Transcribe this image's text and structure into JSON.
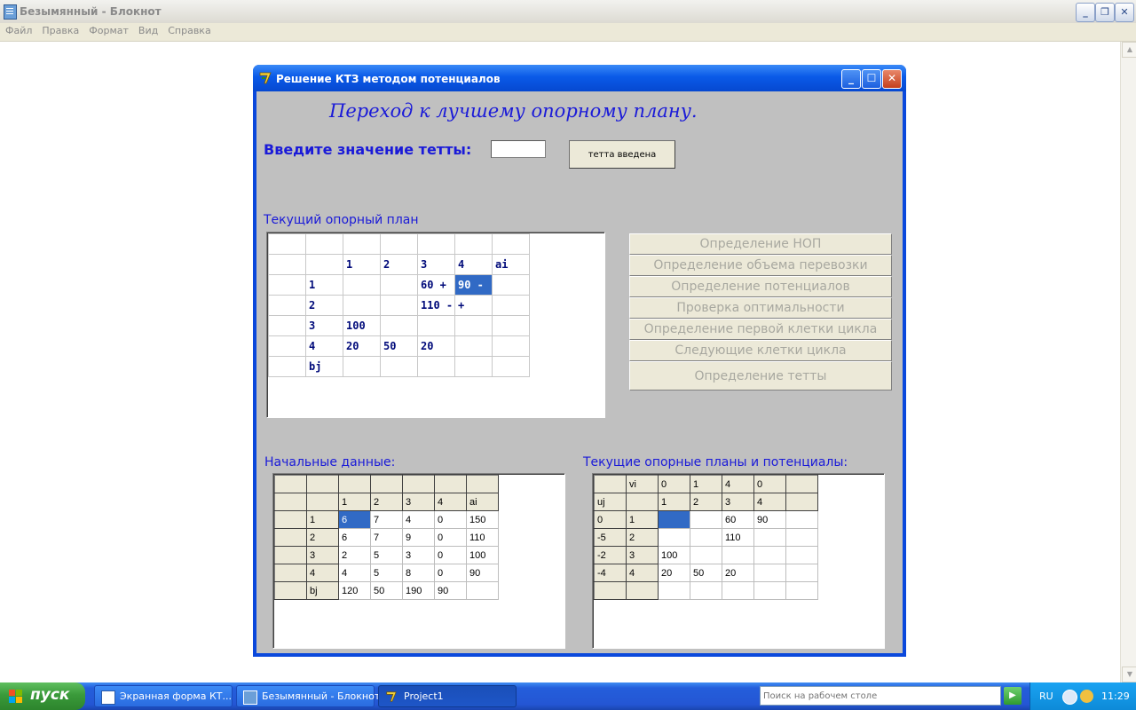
{
  "notepad": {
    "title": "Безымянный - Блокнот",
    "menu": [
      "Файл",
      "Правка",
      "Формат",
      "Вид",
      "Справка"
    ]
  },
  "dialog": {
    "title": "Решение КТЗ методом потенциалов",
    "heading": "Переход к лучшему опорному плану.",
    "theta_label": "Введите значение тетты:",
    "theta_value": "",
    "theta_button": "тетта введена",
    "current_plan_label": "Текущий опорный план",
    "current_plan_grid": [
      [
        "",
        "",
        "",
        "",
        "",
        "",
        ""
      ],
      [
        "",
        "",
        "1",
        "2",
        "3",
        "4",
        "ai"
      ],
      [
        "",
        "1",
        "",
        "",
        "60  +",
        "90  -",
        ""
      ],
      [
        "",
        "2",
        "",
        "",
        "110  -",
        "  +",
        ""
      ],
      [
        "",
        "3",
        "100",
        "",
        "",
        "",
        ""
      ],
      [
        "",
        "4",
        "20",
        "50",
        "20",
        "",
        ""
      ],
      [
        "",
        "bj",
        "",
        "",
        "",
        "",
        ""
      ]
    ],
    "step_buttons": [
      "Определение НОП",
      "Определение объема перевозки",
      "Определение потенциалов",
      "Проверка оптимальности",
      "Определение первой клетки цикла",
      "Следующие клетки цикла",
      "Определение тетты"
    ],
    "initial_data_label": "Начальные данные:",
    "initial_data_grid": [
      [
        "",
        "",
        "",
        "",
        "",
        "",
        ""
      ],
      [
        "",
        "",
        "1",
        "2",
        "3",
        "4",
        "ai"
      ],
      [
        "",
        "1",
        "6",
        "7",
        "4",
        "0",
        "150"
      ],
      [
        "",
        "2",
        "6",
        "7",
        "9",
        "0",
        "110"
      ],
      [
        "",
        "3",
        "2",
        "5",
        "3",
        "0",
        "100"
      ],
      [
        "",
        "4",
        "4",
        "5",
        "8",
        "0",
        "90"
      ],
      [
        "",
        "bj",
        "120",
        "50",
        "190",
        "90",
        ""
      ]
    ],
    "potentials_label": "Текущие опорные планы и потенциалы:",
    "potentials_grid": [
      [
        "",
        "vi",
        "0",
        "1",
        "4",
        "0",
        ""
      ],
      [
        "uj",
        "",
        "1",
        "2",
        "3",
        "4",
        ""
      ],
      [
        "0",
        "1",
        "",
        "",
        "60",
        "90",
        ""
      ],
      [
        "-5",
        "2",
        "",
        "",
        "110",
        "",
        ""
      ],
      [
        "-2",
        "3",
        "100",
        "",
        "",
        "",
        ""
      ],
      [
        "-4",
        "4",
        "20",
        "50",
        "20",
        "",
        ""
      ],
      [
        "",
        "",
        "",
        "",
        "",
        "",
        ""
      ]
    ]
  },
  "taskbar": {
    "start_label": "пуск",
    "tasks": [
      "Экранная форма КТ...",
      "Безымянный - Блокнот",
      "Project1"
    ],
    "search_placeholder": "Поиск на рабочем столе",
    "language": "RU",
    "clock": "11:29"
  },
  "colors": {
    "xp_blue": "#0a48dc",
    "form_gray": "#c0c0c0",
    "label_blue": "#1a1ad8",
    "selection": "#316ac5",
    "start_green": "#3a9a3a"
  }
}
